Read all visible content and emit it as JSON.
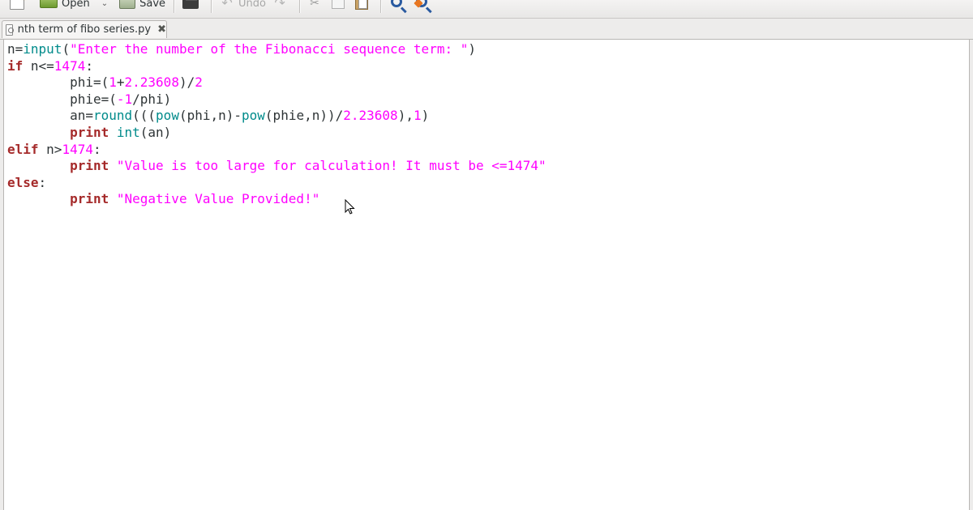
{
  "toolbar": {
    "open_label": "Open",
    "save_label": "Save",
    "undo_label": "Undo"
  },
  "tab": {
    "filename": "nth term of fibo series.py",
    "close_glyph": "✖"
  },
  "code": {
    "lines": [
      [
        {
          "t": "n=",
          "c": "op"
        },
        {
          "t": "input",
          "c": "fn"
        },
        {
          "t": "(",
          "c": "op"
        },
        {
          "t": "\"Enter the number of the Fibonacci sequence term: \"",
          "c": "str"
        },
        {
          "t": ")",
          "c": "op"
        }
      ],
      [
        {
          "t": "if",
          "c": "kw"
        },
        {
          "t": " n<=",
          "c": "op"
        },
        {
          "t": "1474",
          "c": "num"
        },
        {
          "t": ":",
          "c": "op"
        }
      ],
      [
        {
          "t": "        phi=(",
          "c": "op"
        },
        {
          "t": "1",
          "c": "num"
        },
        {
          "t": "+",
          "c": "op"
        },
        {
          "t": "2.23608",
          "c": "num"
        },
        {
          "t": ")/",
          "c": "op"
        },
        {
          "t": "2",
          "c": "num"
        }
      ],
      [
        {
          "t": "        phie=(",
          "c": "op"
        },
        {
          "t": "-1",
          "c": "num"
        },
        {
          "t": "/phi)",
          "c": "op"
        }
      ],
      [
        {
          "t": "        an=",
          "c": "op"
        },
        {
          "t": "round",
          "c": "fn"
        },
        {
          "t": "(((",
          "c": "op"
        },
        {
          "t": "pow",
          "c": "fn"
        },
        {
          "t": "(phi,n)-",
          "c": "op"
        },
        {
          "t": "pow",
          "c": "fn"
        },
        {
          "t": "(phie,n))/",
          "c": "op"
        },
        {
          "t": "2.23608",
          "c": "num"
        },
        {
          "t": "),",
          "c": "op"
        },
        {
          "t": "1",
          "c": "num"
        },
        {
          "t": ")",
          "c": "op"
        }
      ],
      [
        {
          "t": "        ",
          "c": "op"
        },
        {
          "t": "print",
          "c": "kw"
        },
        {
          "t": " ",
          "c": "op"
        },
        {
          "t": "int",
          "c": "fn"
        },
        {
          "t": "(an)",
          "c": "op"
        }
      ],
      [
        {
          "t": "elif",
          "c": "kw"
        },
        {
          "t": " n>",
          "c": "op"
        },
        {
          "t": "1474",
          "c": "num"
        },
        {
          "t": ":",
          "c": "op"
        }
      ],
      [
        {
          "t": "        ",
          "c": "op"
        },
        {
          "t": "print",
          "c": "kw"
        },
        {
          "t": " ",
          "c": "op"
        },
        {
          "t": "\"Value is too large for calculation! It must be <=1474\"",
          "c": "str"
        }
      ],
      [
        {
          "t": "else",
          "c": "kw"
        },
        {
          "t": ":",
          "c": "op"
        }
      ],
      [
        {
          "t": "        ",
          "c": "op"
        },
        {
          "t": "print",
          "c": "kw"
        },
        {
          "t": " ",
          "c": "op"
        },
        {
          "t": "\"Negative Value Provided!\"",
          "c": "str"
        }
      ]
    ]
  },
  "icons": {
    "new": "new-document-icon",
    "open": "open-folder-icon",
    "save": "save-icon",
    "print": "print-icon",
    "undo": "undo-icon",
    "redo": "redo-icon",
    "cut": "cut-icon",
    "copy": "copy-icon",
    "paste": "paste-icon",
    "find": "find-icon",
    "replace": "find-replace-icon"
  }
}
